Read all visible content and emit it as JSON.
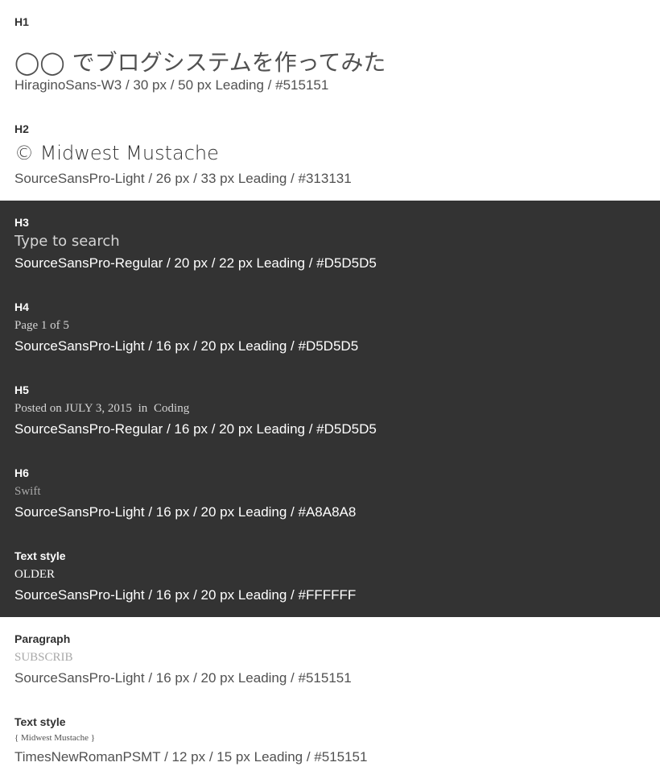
{
  "h1": {
    "label": "H1",
    "sample": "◯◯ でブログシステムを作ってみた",
    "spec": "HiraginoSans-W3 / 30 px / 50 px Leading / #515151"
  },
  "h2": {
    "label": "H2",
    "sample": "© Midwest Mustache",
    "spec": "SourceSansPro-Light / 26 px / 33 px Leading / #313131"
  },
  "h3": {
    "label": "H3",
    "sample": "Type to search",
    "spec": "SourceSansPro-Regular / 20 px / 22 px Leading / #D5D5D5"
  },
  "h4": {
    "label": "H4",
    "sample": "Page 1 of 5",
    "spec": "SourceSansPro-Light / 16 px / 20 px Leading / #D5D5D5"
  },
  "h5": {
    "label": "H5",
    "posted_on": "Posted on",
    "date": "JULY 3, 2015",
    "in": "in",
    "category": "Coding",
    "spec": "SourceSansPro-Regular / 16 px / 20 px Leading / #D5D5D5"
  },
  "h6": {
    "label": "H6",
    "sample": "Swift",
    "spec": "SourceSansPro-Light / 16 px / 20 px Leading / #A8A8A8"
  },
  "text_style_1": {
    "label": "Text style",
    "sample": "OLDER",
    "spec": "SourceSansPro-Light / 16 px / 20 px Leading / #FFFFFF"
  },
  "paragraph": {
    "label": "Paragraph",
    "sample": "SUBSCRIB",
    "spec": "SourceSansPro-Light / 16 px / 20 px Leading / #515151"
  },
  "text_style_2": {
    "label": "Text style",
    "sample": "{ Midwest Mustache }",
    "spec": "TimesNewRomanPSMT / 12 px / 15 px Leading / #515151"
  },
  "colors": {
    "dark_background": "#333333",
    "light_background": "#FFFFFF"
  }
}
